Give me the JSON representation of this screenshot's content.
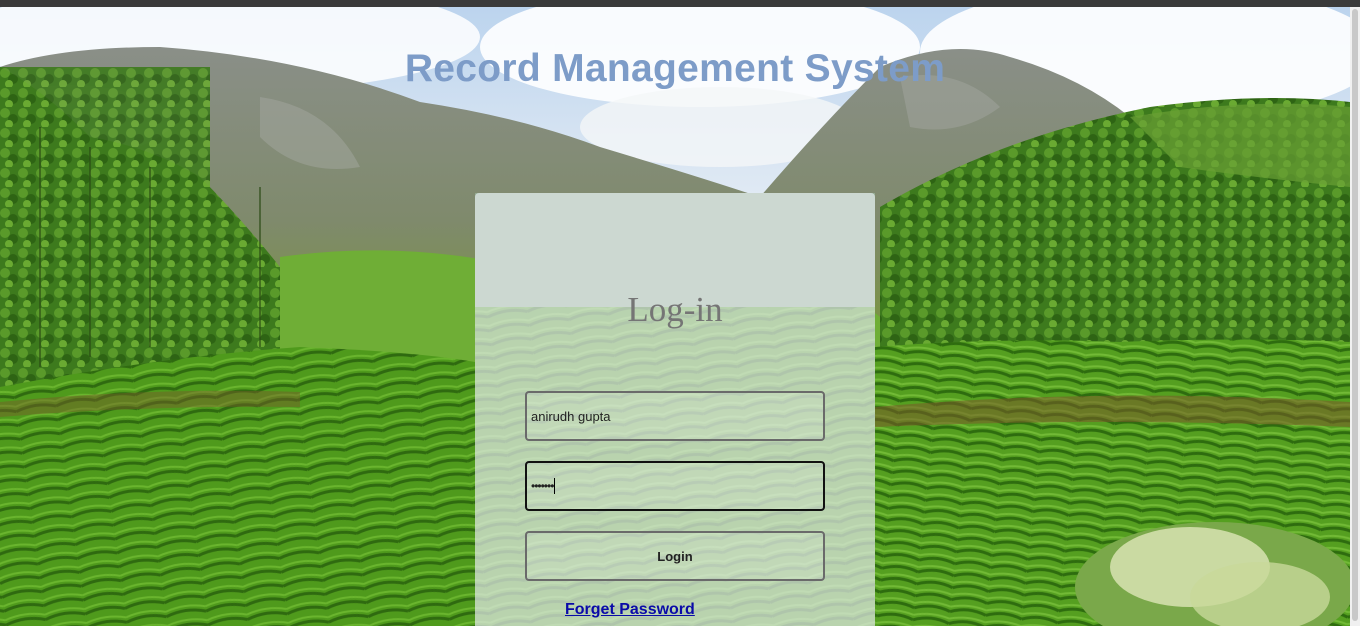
{
  "app": {
    "title": "Record Management System"
  },
  "login": {
    "heading": "Log-in",
    "username_value": "anirudh gupta",
    "password_masked": "•••••••",
    "login_label": "Login",
    "forget_password_label": "Forget Password"
  },
  "colors": {
    "title": "#7d9cc8",
    "link": "#0a0aa8",
    "heading": "#757575",
    "panel": "rgba(232,238,240,0.68)"
  },
  "icons": {
    "background": "tea-plantation-landscape-image"
  }
}
